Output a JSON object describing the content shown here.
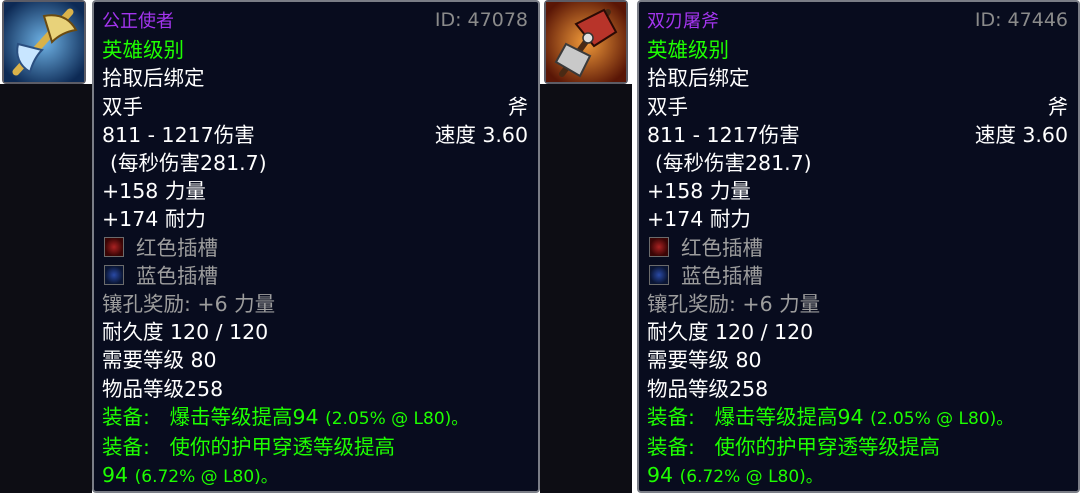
{
  "items": [
    {
      "name": "公正使者",
      "id": "ID: 47078",
      "quality": "英雄级别",
      "bind": "拾取后绑定",
      "slot": "双手",
      "type": "斧",
      "damage": "811 - 1217伤害",
      "speed": "速度 3.60",
      "dps": "(每秒伤害281.7)",
      "stats": [
        "+158 力量",
        "+174 耐力"
      ],
      "sockets": [
        {
          "color": "red",
          "label": "红色插槽"
        },
        {
          "color": "blue",
          "label": "蓝色插槽"
        }
      ],
      "socket_bonus": "镶孔奖励: +6 力量",
      "durability": "耐久度 120 / 120",
      "required_level": "需要等级 80",
      "item_level": "物品等级258",
      "equip1_prefix": "装备:",
      "equip1_text": "爆击等级提高94",
      "equip1_note": "(2.05% @ L80)。",
      "equip2_prefix": "装备:",
      "equip2_text": "使你的护甲穿透等级提高",
      "equip2_value": "94",
      "equip2_note": "(6.72% @ L80)。",
      "icon": "golden-axe-icon"
    },
    {
      "name": "双刃屠斧",
      "id": "ID: 47446",
      "quality": "英雄级别",
      "bind": "拾取后绑定",
      "slot": "双手",
      "type": "斧",
      "damage": "811 - 1217伤害",
      "speed": "速度 3.60",
      "dps": "(每秒伤害281.7)",
      "stats": [
        "+158 力量",
        "+174 耐力"
      ],
      "sockets": [
        {
          "color": "red",
          "label": "红色插槽"
        },
        {
          "color": "blue",
          "label": "蓝色插槽"
        }
      ],
      "socket_bonus": "镶孔奖励: +6 力量",
      "durability": "耐久度 120 / 120",
      "required_level": "需要等级 80",
      "item_level": "物品等级258",
      "equip1_prefix": "装备:",
      "equip1_text": "爆击等级提高94",
      "equip1_note": "(2.05% @ L80)。",
      "equip2_prefix": "装备:",
      "equip2_text": "使你的护甲穿透等级提高",
      "equip2_value": "94",
      "equip2_note": "(6.72% @ L80)。",
      "icon": "red-double-axe-icon"
    }
  ],
  "colors": {
    "tooltip_bg": "#080c1e",
    "epic_purple": "#a335ee",
    "green": "#1eff00",
    "gray": "#9d9d9d",
    "white": "#ffffff"
  }
}
